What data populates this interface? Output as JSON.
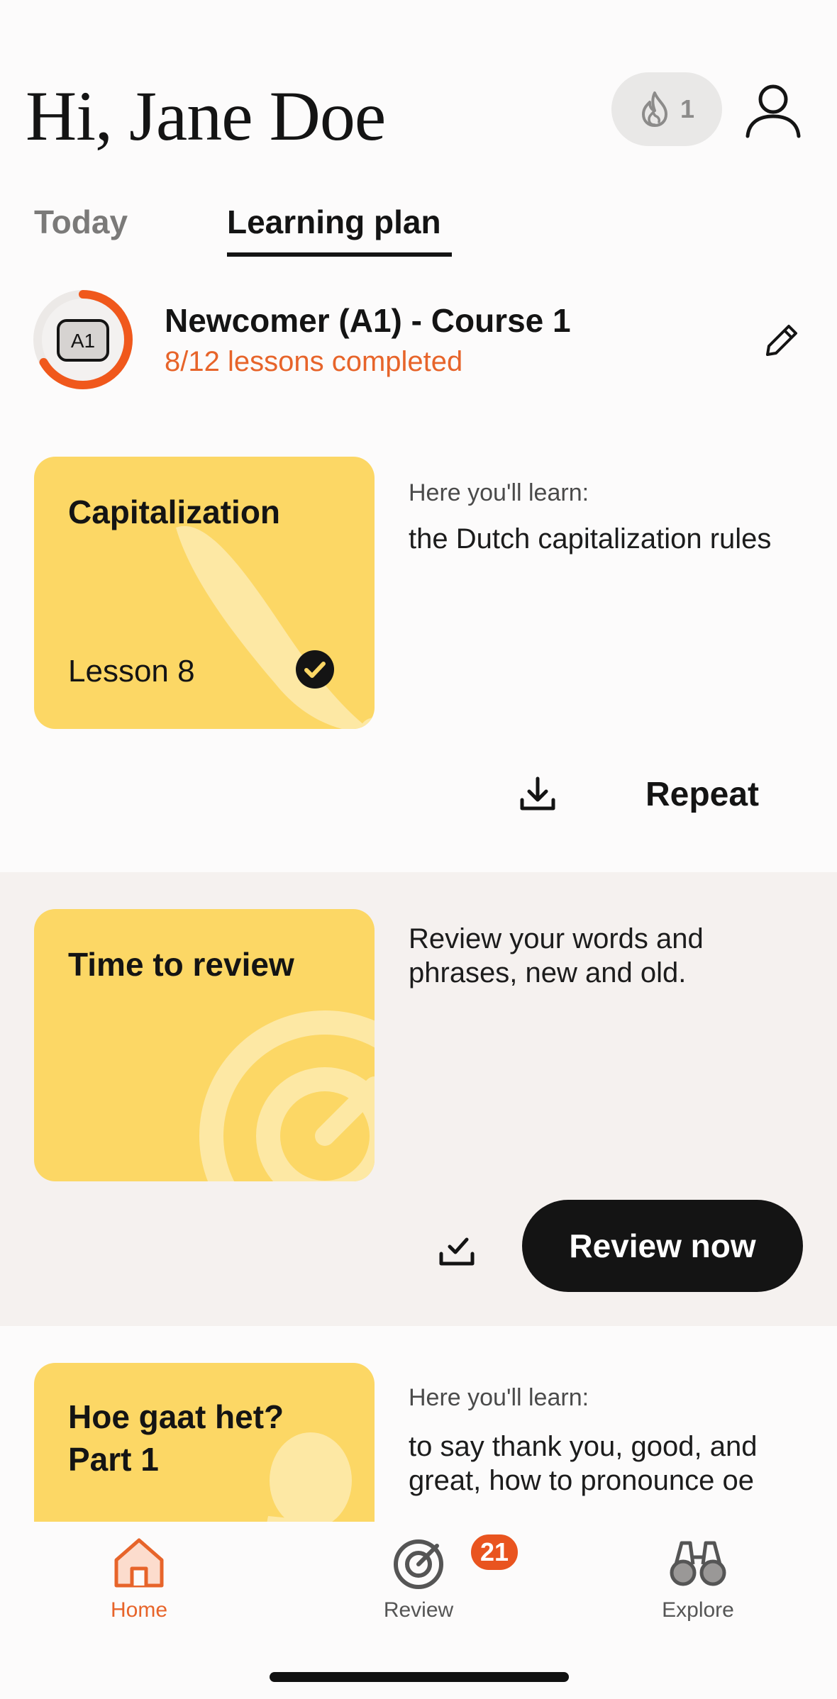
{
  "header": {
    "greeting": "Hi, Jane Doe",
    "streak_count": "1",
    "streak_icon": "flame-icon",
    "profile_icon": "user-icon"
  },
  "tabs": [
    {
      "label": "Today",
      "active": false
    },
    {
      "label": "Learning plan",
      "active": true
    }
  ],
  "course": {
    "level_badge": "A1",
    "title": "Newcomer (A1) - Course 1",
    "progress_text": "8/12 lessons completed",
    "progress_fraction": 0.6667,
    "edit_icon": "pencil-icon"
  },
  "lessons": [
    {
      "title": "Capitalization",
      "subtitle": "Lesson 8",
      "completed": true,
      "learn_label": "Here you'll learn:",
      "learn_text": "the Dutch capitalization rules",
      "download_icon": "download-icon",
      "action_label": "Repeat"
    },
    {
      "title": "Time to review",
      "description": "Review your words and phrases, new and old.",
      "mark_icon": "check-tray-icon",
      "action_label": "Review now"
    },
    {
      "title": "Hoe gaat het? Part 1",
      "learn_label": "Here you'll learn:",
      "learn_text": "to say thank you, good, and great, how to pronounce oe"
    }
  ],
  "bottom_nav": [
    {
      "label": "Home",
      "icon": "home-icon",
      "active": true
    },
    {
      "label": "Review",
      "icon": "target-icon",
      "active": false,
      "badge": "21"
    },
    {
      "label": "Explore",
      "icon": "binoculars-icon",
      "active": false
    }
  ],
  "colors": {
    "accent": "#e7642a",
    "card_yellow": "#fcd765",
    "review_band": "#f5f1ef",
    "text_dark": "#141414"
  }
}
